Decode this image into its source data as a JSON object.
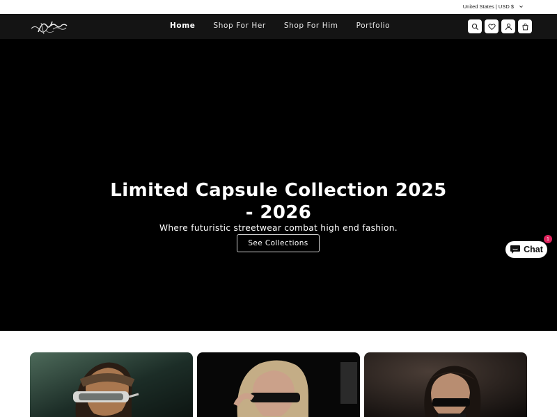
{
  "utility": {
    "country": "United States | USD $",
    "country_icon": "chevron-down-icon"
  },
  "header": {
    "logo_icon": "brand-logo-icon",
    "nav": [
      {
        "label": "Home",
        "active": true
      },
      {
        "label": "Shop For Her",
        "active": false
      },
      {
        "label": "Shop For Him",
        "active": false
      },
      {
        "label": "Portfolio",
        "active": false
      }
    ],
    "icons": [
      "search-icon",
      "heart-icon",
      "account-icon",
      "cart-icon"
    ]
  },
  "hero": {
    "title_bold": "Limited Capsule",
    "title_rest": "Collection 2025 - 2026",
    "subtitle": "Where futuristic streetwear combat high end fashion.",
    "cta": "See Collections"
  },
  "chat": {
    "label": "Chat",
    "badge": "1",
    "icon": "chat-bubble-icon"
  },
  "cards": [
    {
      "icon": "model-photo-visor-male"
    },
    {
      "icon": "model-photo-visor-blonde"
    },
    {
      "icon": "model-photo-visor-dark-hair"
    }
  ],
  "colors": {
    "header_bg": "#141414",
    "hero_bg": "#000000",
    "badge": "#e0245e"
  }
}
